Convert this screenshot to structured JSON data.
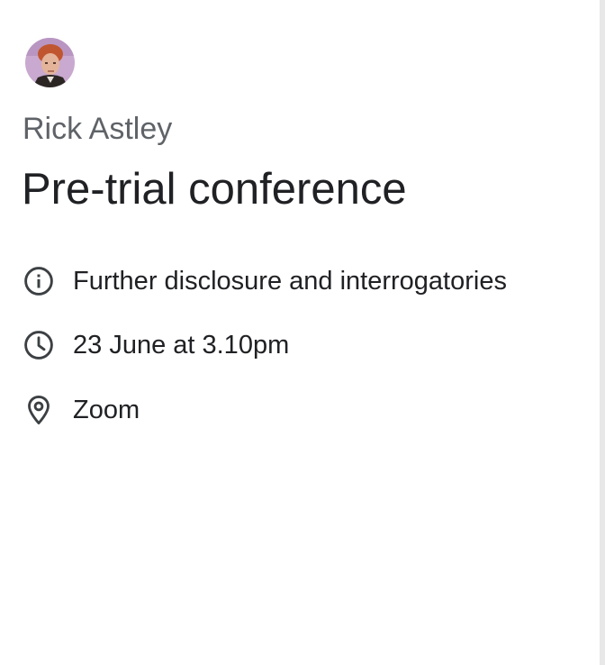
{
  "event": {
    "organizer": "Rick Astley",
    "title": "Pre-trial conference",
    "details": "Further disclosure and interrogatories",
    "time": "23 June at 3.10pm",
    "location": "Zoom"
  },
  "icons": {
    "details": "info-icon",
    "time": "clock-icon",
    "location": "location-pin-icon"
  },
  "colors": {
    "primary_text": "#202124",
    "secondary_text": "#5f6368",
    "icon": "#3c4043",
    "divider": "#e8e8e8"
  }
}
